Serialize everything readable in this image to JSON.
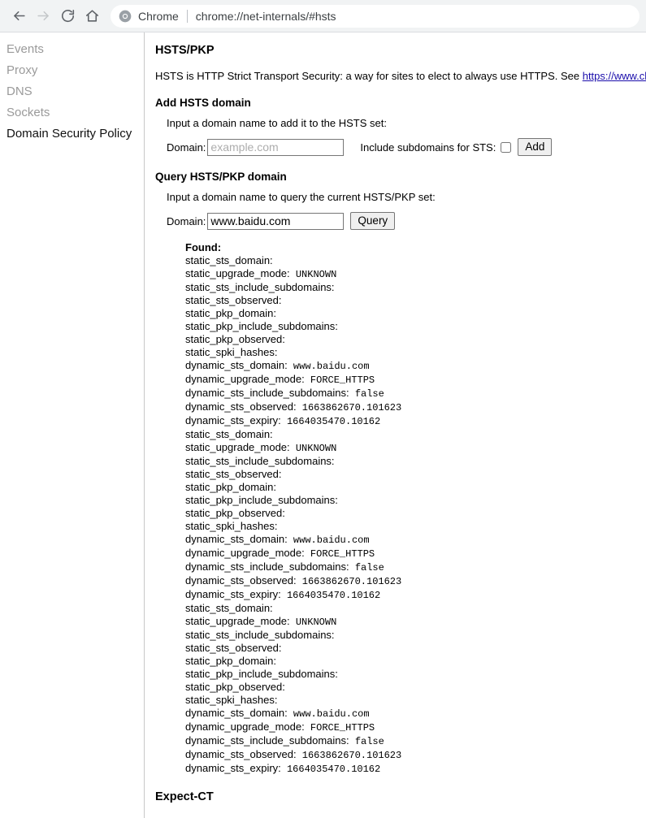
{
  "browser": {
    "back_label": "Back",
    "forward_label": "Forward",
    "reload_label": "Reload",
    "home_label": "Home",
    "brand": "Chrome",
    "url": "chrome://net-internals/#hsts"
  },
  "sidebar": {
    "items": [
      {
        "label": "Events",
        "selected": false
      },
      {
        "label": "Proxy",
        "selected": false
      },
      {
        "label": "DNS",
        "selected": false
      },
      {
        "label": "Sockets",
        "selected": false
      },
      {
        "label": "Domain Security Policy",
        "selected": true
      }
    ]
  },
  "main": {
    "section_title": "HSTS/PKP",
    "description_prefix": "HSTS is HTTP Strict Transport Security: a way for sites to elect to always use HTTPS. See ",
    "description_link": "https://www.chromium.org",
    "add": {
      "heading": "Add HSTS domain",
      "hint": "Input a domain name to add it to the HSTS set:",
      "domain_label": "Domain:",
      "domain_value": "",
      "domain_placeholder": "example.com",
      "subdomains_label": "Include subdomains for STS:",
      "subdomains_checked": false,
      "button_label": "Add"
    },
    "query": {
      "heading": "Query HSTS/PKP domain",
      "hint": "Input a domain name to query the current HSTS/PKP set:",
      "domain_label": "Domain:",
      "domain_value": "www.baidu.com",
      "button_label": "Query"
    },
    "results": {
      "found_label": "Found:",
      "lines": [
        {
          "key": "static_sts_domain:",
          "value": ""
        },
        {
          "key": "static_upgrade_mode:",
          "value": "UNKNOWN"
        },
        {
          "key": "static_sts_include_subdomains:",
          "value": ""
        },
        {
          "key": "static_sts_observed:",
          "value": ""
        },
        {
          "key": "static_pkp_domain:",
          "value": ""
        },
        {
          "key": "static_pkp_include_subdomains:",
          "value": ""
        },
        {
          "key": "static_pkp_observed:",
          "value": ""
        },
        {
          "key": "static_spki_hashes:",
          "value": ""
        },
        {
          "key": "dynamic_sts_domain:",
          "value": "www.baidu.com"
        },
        {
          "key": "dynamic_upgrade_mode:",
          "value": "FORCE_HTTPS"
        },
        {
          "key": "dynamic_sts_include_subdomains:",
          "value": "false"
        },
        {
          "key": "dynamic_sts_observed:",
          "value": "1663862670.101623"
        },
        {
          "key": "dynamic_sts_expiry:",
          "value": "1664035470.10162"
        },
        {
          "key": "static_sts_domain:",
          "value": ""
        },
        {
          "key": "static_upgrade_mode:",
          "value": "UNKNOWN"
        },
        {
          "key": "static_sts_include_subdomains:",
          "value": ""
        },
        {
          "key": "static_sts_observed:",
          "value": ""
        },
        {
          "key": "static_pkp_domain:",
          "value": ""
        },
        {
          "key": "static_pkp_include_subdomains:",
          "value": ""
        },
        {
          "key": "static_pkp_observed:",
          "value": ""
        },
        {
          "key": "static_spki_hashes:",
          "value": ""
        },
        {
          "key": "dynamic_sts_domain:",
          "value": "www.baidu.com"
        },
        {
          "key": "dynamic_upgrade_mode:",
          "value": "FORCE_HTTPS"
        },
        {
          "key": "dynamic_sts_include_subdomains:",
          "value": "false"
        },
        {
          "key": "dynamic_sts_observed:",
          "value": "1663862670.101623"
        },
        {
          "key": "dynamic_sts_expiry:",
          "value": "1664035470.10162"
        },
        {
          "key": "static_sts_domain:",
          "value": ""
        },
        {
          "key": "static_upgrade_mode:",
          "value": "UNKNOWN"
        },
        {
          "key": "static_sts_include_subdomains:",
          "value": ""
        },
        {
          "key": "static_sts_observed:",
          "value": ""
        },
        {
          "key": "static_pkp_domain:",
          "value": ""
        },
        {
          "key": "static_pkp_include_subdomains:",
          "value": ""
        },
        {
          "key": "static_pkp_observed:",
          "value": ""
        },
        {
          "key": "static_spki_hashes:",
          "value": ""
        },
        {
          "key": "dynamic_sts_domain:",
          "value": "www.baidu.com"
        },
        {
          "key": "dynamic_upgrade_mode:",
          "value": "FORCE_HTTPS"
        },
        {
          "key": "dynamic_sts_include_subdomains:",
          "value": "false"
        },
        {
          "key": "dynamic_sts_observed:",
          "value": "1663862670.101623"
        },
        {
          "key": "dynamic_sts_expiry:",
          "value": "1664035470.10162"
        }
      ]
    },
    "expect_ct_heading": "Expect-CT"
  },
  "colors": {
    "link": "#1a0dab",
    "toolbar_bg": "#f1f3f4",
    "sidebar_text": "#9a9a9a",
    "selected_text": "#101010"
  }
}
